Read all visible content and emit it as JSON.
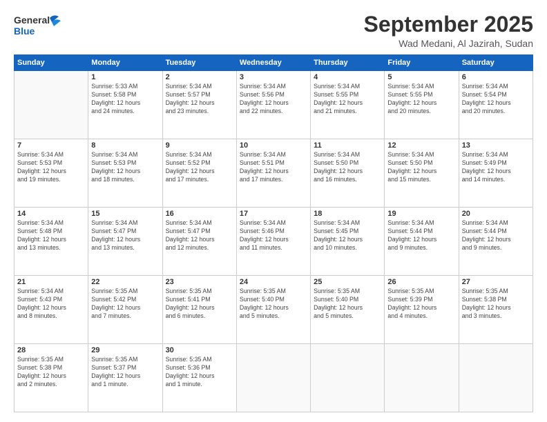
{
  "header": {
    "logo_line1": "General",
    "logo_line2": "Blue",
    "month": "September 2025",
    "location": "Wad Medani, Al Jazirah, Sudan"
  },
  "weekdays": [
    "Sunday",
    "Monday",
    "Tuesday",
    "Wednesday",
    "Thursday",
    "Friday",
    "Saturday"
  ],
  "weeks": [
    [
      {
        "day": "",
        "info": ""
      },
      {
        "day": "1",
        "info": "Sunrise: 5:33 AM\nSunset: 5:58 PM\nDaylight: 12 hours\nand 24 minutes."
      },
      {
        "day": "2",
        "info": "Sunrise: 5:34 AM\nSunset: 5:57 PM\nDaylight: 12 hours\nand 23 minutes."
      },
      {
        "day": "3",
        "info": "Sunrise: 5:34 AM\nSunset: 5:56 PM\nDaylight: 12 hours\nand 22 minutes."
      },
      {
        "day": "4",
        "info": "Sunrise: 5:34 AM\nSunset: 5:55 PM\nDaylight: 12 hours\nand 21 minutes."
      },
      {
        "day": "5",
        "info": "Sunrise: 5:34 AM\nSunset: 5:55 PM\nDaylight: 12 hours\nand 20 minutes."
      },
      {
        "day": "6",
        "info": "Sunrise: 5:34 AM\nSunset: 5:54 PM\nDaylight: 12 hours\nand 20 minutes."
      }
    ],
    [
      {
        "day": "7",
        "info": "Sunrise: 5:34 AM\nSunset: 5:53 PM\nDaylight: 12 hours\nand 19 minutes."
      },
      {
        "day": "8",
        "info": "Sunrise: 5:34 AM\nSunset: 5:53 PM\nDaylight: 12 hours\nand 18 minutes."
      },
      {
        "day": "9",
        "info": "Sunrise: 5:34 AM\nSunset: 5:52 PM\nDaylight: 12 hours\nand 17 minutes."
      },
      {
        "day": "10",
        "info": "Sunrise: 5:34 AM\nSunset: 5:51 PM\nDaylight: 12 hours\nand 17 minutes."
      },
      {
        "day": "11",
        "info": "Sunrise: 5:34 AM\nSunset: 5:50 PM\nDaylight: 12 hours\nand 16 minutes."
      },
      {
        "day": "12",
        "info": "Sunrise: 5:34 AM\nSunset: 5:50 PM\nDaylight: 12 hours\nand 15 minutes."
      },
      {
        "day": "13",
        "info": "Sunrise: 5:34 AM\nSunset: 5:49 PM\nDaylight: 12 hours\nand 14 minutes."
      }
    ],
    [
      {
        "day": "14",
        "info": "Sunrise: 5:34 AM\nSunset: 5:48 PM\nDaylight: 12 hours\nand 13 minutes."
      },
      {
        "day": "15",
        "info": "Sunrise: 5:34 AM\nSunset: 5:47 PM\nDaylight: 12 hours\nand 13 minutes."
      },
      {
        "day": "16",
        "info": "Sunrise: 5:34 AM\nSunset: 5:47 PM\nDaylight: 12 hours\nand 12 minutes."
      },
      {
        "day": "17",
        "info": "Sunrise: 5:34 AM\nSunset: 5:46 PM\nDaylight: 12 hours\nand 11 minutes."
      },
      {
        "day": "18",
        "info": "Sunrise: 5:34 AM\nSunset: 5:45 PM\nDaylight: 12 hours\nand 10 minutes."
      },
      {
        "day": "19",
        "info": "Sunrise: 5:34 AM\nSunset: 5:44 PM\nDaylight: 12 hours\nand 9 minutes."
      },
      {
        "day": "20",
        "info": "Sunrise: 5:34 AM\nSunset: 5:44 PM\nDaylight: 12 hours\nand 9 minutes."
      }
    ],
    [
      {
        "day": "21",
        "info": "Sunrise: 5:34 AM\nSunset: 5:43 PM\nDaylight: 12 hours\nand 8 minutes."
      },
      {
        "day": "22",
        "info": "Sunrise: 5:35 AM\nSunset: 5:42 PM\nDaylight: 12 hours\nand 7 minutes."
      },
      {
        "day": "23",
        "info": "Sunrise: 5:35 AM\nSunset: 5:41 PM\nDaylight: 12 hours\nand 6 minutes."
      },
      {
        "day": "24",
        "info": "Sunrise: 5:35 AM\nSunset: 5:40 PM\nDaylight: 12 hours\nand 5 minutes."
      },
      {
        "day": "25",
        "info": "Sunrise: 5:35 AM\nSunset: 5:40 PM\nDaylight: 12 hours\nand 5 minutes."
      },
      {
        "day": "26",
        "info": "Sunrise: 5:35 AM\nSunset: 5:39 PM\nDaylight: 12 hours\nand 4 minutes."
      },
      {
        "day": "27",
        "info": "Sunrise: 5:35 AM\nSunset: 5:38 PM\nDaylight: 12 hours\nand 3 minutes."
      }
    ],
    [
      {
        "day": "28",
        "info": "Sunrise: 5:35 AM\nSunset: 5:38 PM\nDaylight: 12 hours\nand 2 minutes."
      },
      {
        "day": "29",
        "info": "Sunrise: 5:35 AM\nSunset: 5:37 PM\nDaylight: 12 hours\nand 1 minute."
      },
      {
        "day": "30",
        "info": "Sunrise: 5:35 AM\nSunset: 5:36 PM\nDaylight: 12 hours\nand 1 minute."
      },
      {
        "day": "",
        "info": ""
      },
      {
        "day": "",
        "info": ""
      },
      {
        "day": "",
        "info": ""
      },
      {
        "day": "",
        "info": ""
      }
    ]
  ]
}
